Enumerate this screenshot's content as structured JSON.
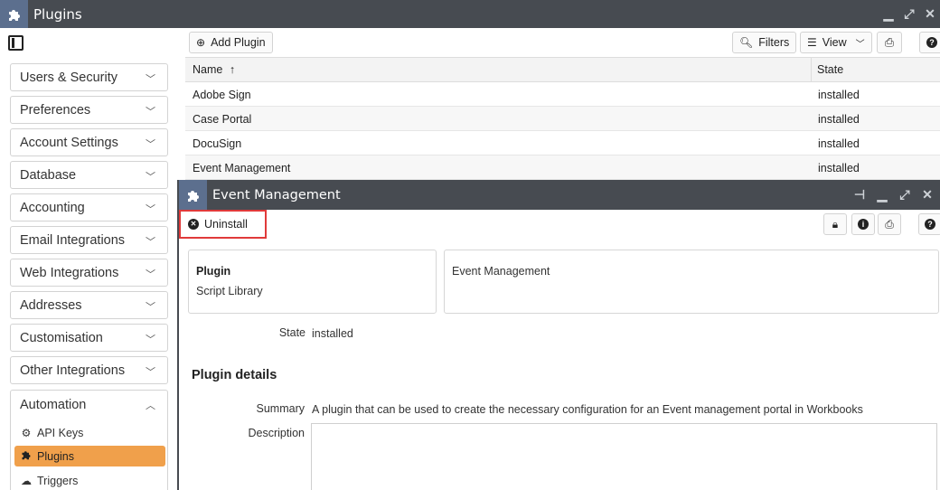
{
  "window": {
    "title": "Plugins"
  },
  "sidebar": {
    "sections": [
      {
        "label": "Users & Security"
      },
      {
        "label": "Preferences"
      },
      {
        "label": "Account Settings"
      },
      {
        "label": "Database"
      },
      {
        "label": "Accounting"
      },
      {
        "label": "Email Integrations"
      },
      {
        "label": "Web Integrations"
      },
      {
        "label": "Addresses"
      },
      {
        "label": "Customisation"
      },
      {
        "label": "Other Integrations"
      }
    ],
    "open_section": {
      "label": "Automation",
      "items": [
        {
          "label": "API Keys",
          "icon": "gear-icon"
        },
        {
          "label": "Plugins",
          "icon": "puzzle-icon",
          "active": true
        },
        {
          "label": "Triggers",
          "icon": "cloud-icon"
        }
      ]
    }
  },
  "toolbar": {
    "add_label": "Add Plugin",
    "filters_label": "Filters",
    "view_label": "View"
  },
  "grid": {
    "columns": [
      "Name",
      "State"
    ],
    "rows": [
      {
        "name": "Adobe Sign",
        "state": "installed"
      },
      {
        "name": "Case Portal",
        "state": "installed"
      },
      {
        "name": "DocuSign",
        "state": "installed"
      },
      {
        "name": "Event Management",
        "state": "installed"
      }
    ]
  },
  "dialog": {
    "title": "Event Management",
    "uninstall_label": "Uninstall",
    "plugin_card": {
      "label": "Plugin",
      "value": "Script Library"
    },
    "name_card": {
      "value": "Event Management"
    },
    "state_label": "State",
    "state_value": "installed",
    "details_title": "Plugin details",
    "summary_label": "Summary",
    "summary_value": "A plugin that can be used to create the necessary configuration for an Event management portal in Workbooks",
    "description_label": "Description"
  },
  "colors": {
    "titlebar": "#474b51",
    "accent": "#f0a04b",
    "highlight": "#e03a3a"
  }
}
